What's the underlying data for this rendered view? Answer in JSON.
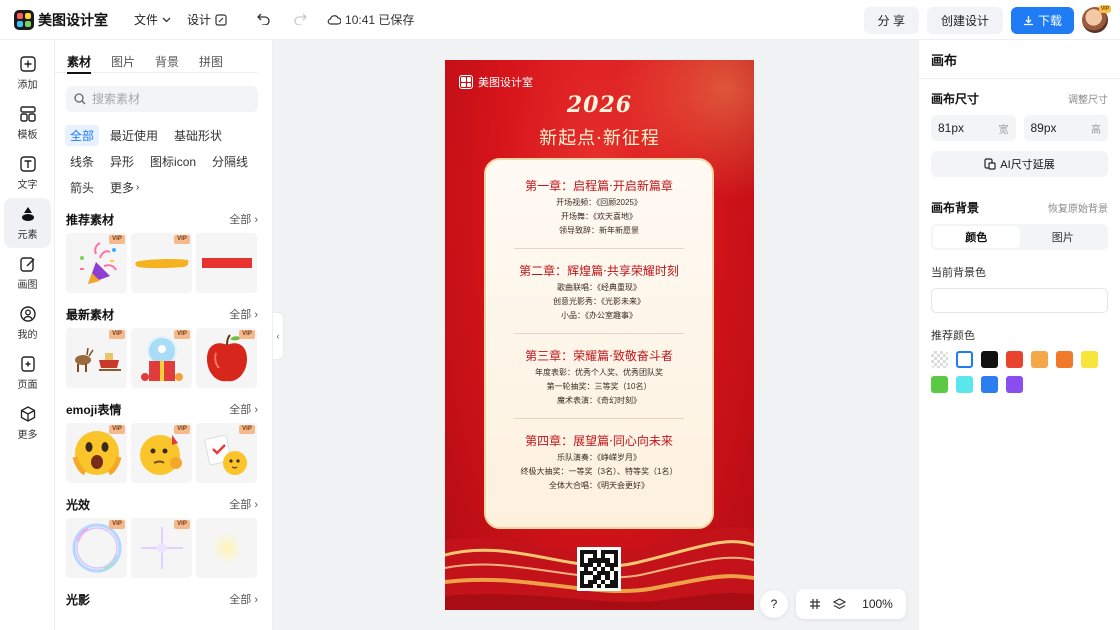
{
  "app": {
    "name": "美图设计室",
    "menu": [
      {
        "label": "文件",
        "icon": "chevron-down-icon"
      },
      {
        "label": "设计",
        "icon": "edit-icon"
      }
    ],
    "saved_status": "10:41 已保存",
    "share_label": "分 享",
    "create_label": "创建设计",
    "download_label": "下载",
    "avatar_badge": "VIP"
  },
  "rail": [
    {
      "label": "添加",
      "icon": "plus-square-icon"
    },
    {
      "label": "模板",
      "icon": "template-icon"
    },
    {
      "label": "文字",
      "icon": "text-icon"
    },
    {
      "label": "元素",
      "icon": "shapes-icon",
      "active": true
    },
    {
      "label": "画图",
      "icon": "draw-icon"
    },
    {
      "label": "我的",
      "icon": "user-icon"
    },
    {
      "label": "页面",
      "icon": "add-page-icon"
    },
    {
      "label": "更多",
      "icon": "cube-icon"
    }
  ],
  "panel": {
    "tabs": [
      {
        "label": "素材",
        "active": true
      },
      {
        "label": "图片"
      },
      {
        "label": "背景"
      },
      {
        "label": "拼图"
      }
    ],
    "search_placeholder": "搜索素材",
    "chips": [
      "全部",
      "最近使用",
      "基础形状",
      "线条",
      "异形",
      "图标icon",
      "分隔线",
      "箭头",
      "更多"
    ],
    "see_all": "全部",
    "vip_badge": "VIP",
    "sections": [
      {
        "title": "推荐素材",
        "items": [
          {
            "icon": "party-popper-icon",
            "vip": true
          },
          {
            "icon": "brush-stroke-icon",
            "vip": true
          },
          {
            "icon": "red-bar-icon",
            "vip": false
          }
        ]
      },
      {
        "title": "最新素材",
        "items": [
          {
            "icon": "reindeer-sleigh-icon",
            "vip": true
          },
          {
            "icon": "snow-globe-icon",
            "vip": true
          },
          {
            "icon": "apple-icon",
            "vip": true
          }
        ]
      },
      {
        "title": "emoji表情",
        "items": [
          {
            "icon": "shocked-emoji-icon",
            "vip": true
          },
          {
            "icon": "thinking-emoji-icon",
            "vip": true
          },
          {
            "icon": "note-emoji-icon",
            "vip": true
          }
        ]
      },
      {
        "title": "光效",
        "items": [
          {
            "icon": "bubble-light-icon",
            "vip": true
          },
          {
            "icon": "star-glint-icon",
            "vip": true
          },
          {
            "icon": "glow-icon",
            "vip": false
          }
        ]
      },
      {
        "title": "光影",
        "items": []
      }
    ]
  },
  "poster": {
    "brand": "美图设计室",
    "year": "2026",
    "headline": "新起点·新征程",
    "chapters": [
      {
        "title": "第一章：启程篇·开启新篇章",
        "lines": [
          "开场视频：《回顾2025》",
          "开场舞：《欢天喜地》",
          "领导致辞：新年新愿景"
        ]
      },
      {
        "title": "第二章：辉煌篇·共享荣耀时刻",
        "lines": [
          "歌曲联唱：《经典重现》",
          "创意光影秀：《光影未来》",
          "小品：《办公室趣事》"
        ]
      },
      {
        "title": "第三章：荣耀篇·致敬奋斗者",
        "lines": [
          "年度表彰：优秀个人奖、优秀团队奖",
          "第一轮抽奖：三等奖（10名）",
          "魔术表演：《奇幻时刻》"
        ]
      },
      {
        "title": "第四章：展望篇·同心向未来",
        "lines": [
          "乐队演奏：《峥嵘岁月》",
          "终极大抽奖：一等奖（3名）、特等奖（1名）",
          "全体大合唱：《明天会更好》"
        ]
      }
    ]
  },
  "canvas_tools": {
    "help": "?",
    "zoom": "100%"
  },
  "right_panel": {
    "title": "画布",
    "size_label": "画布尺寸",
    "resize_link": "调整尺寸",
    "width_value": "81px",
    "width_unit": "宽",
    "height_value": "89px",
    "height_unit": "高",
    "ai_extend_label": "AI尺寸延展",
    "bg_label": "画布背景",
    "bg_reset_link": "恢复原始背景",
    "bg_tabs": [
      "颜色",
      "图片"
    ],
    "current_bg_label": "当前背景色",
    "recommended_label": "推荐颜色",
    "swatches": [
      "transparent",
      "#ffffff",
      "#111111",
      "#e8432e",
      "#f5a84a",
      "#f07a2a",
      "#f8e53b",
      "#5bc944",
      "#5ae6ea",
      "#2b7ef0",
      "#8a4ef0"
    ]
  },
  "colors": {
    "accent": "#1f7cf5",
    "poster_red": "#d7151b",
    "poster_gold": "#f4d6a4"
  }
}
